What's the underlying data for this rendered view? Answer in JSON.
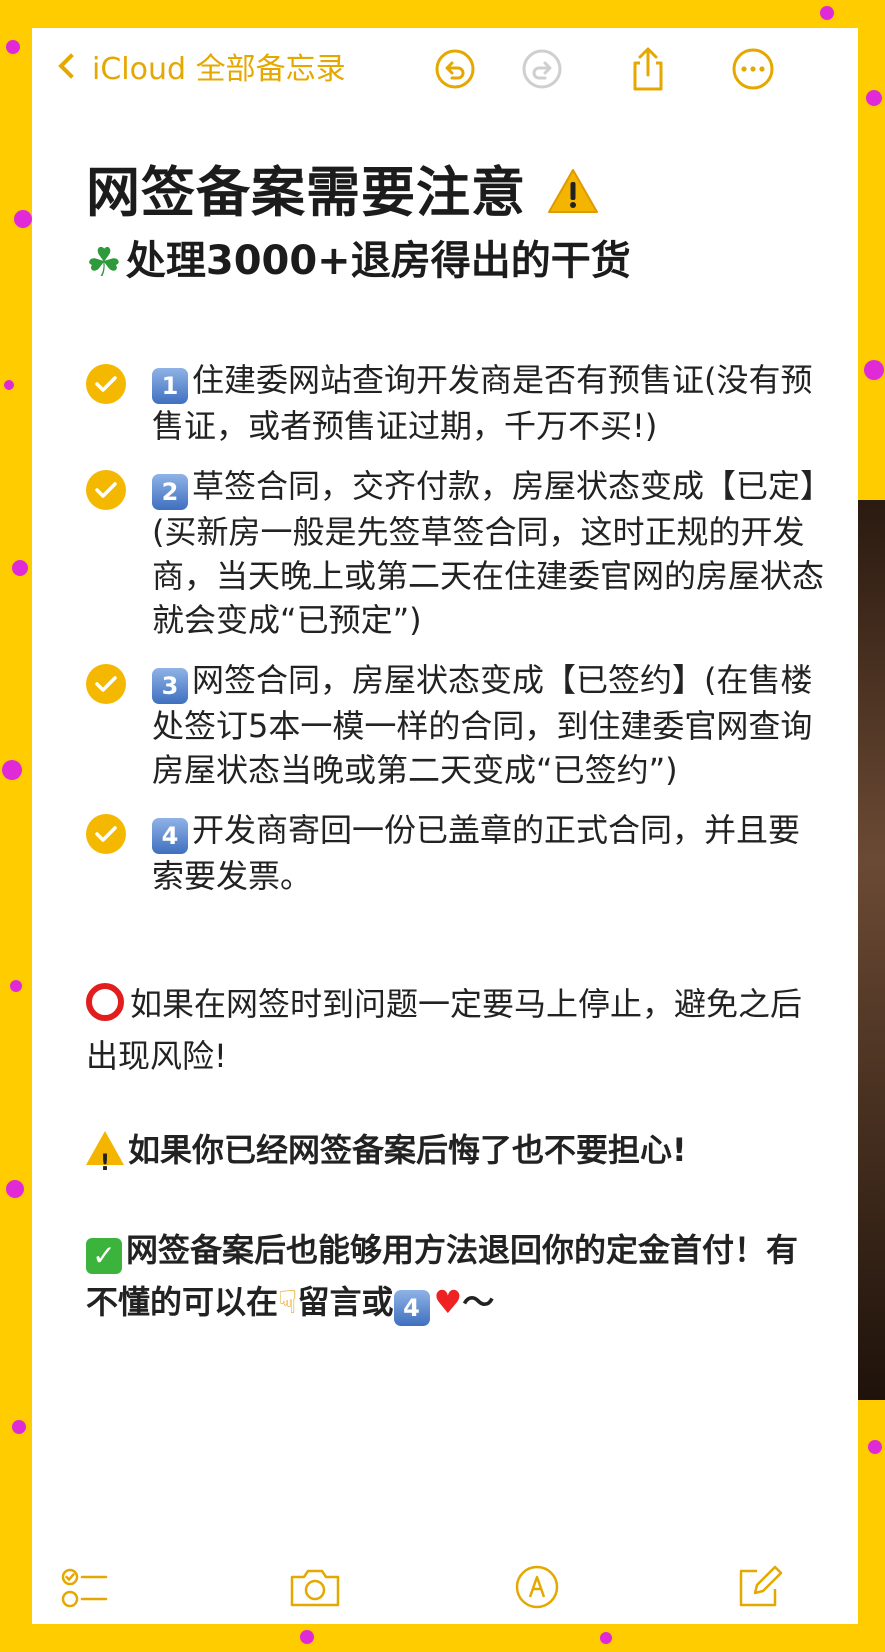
{
  "nav": {
    "back_label": "iCloud 全部备忘录",
    "icons": [
      "undo-icon",
      "redo-icon",
      "share-icon",
      "more-icon"
    ]
  },
  "note": {
    "title": "网签备案需要注意",
    "subtitle": "处理3000+退房得出的干货",
    "items": [
      {
        "badge": "1",
        "text": "住建委网站查询开发商是否有预售证(没有预售证，或者预售证过期，千万不买!)"
      },
      {
        "badge": "2",
        "text": "草签合同，交齐付款，房屋状态变成【已定】(买新房一般是先签草签合同，这时正规的开发商，当天晚上或第二天在住建委官网的房屋状态就会变成“已预定”)"
      },
      {
        "badge": "3",
        "text": "网签合同，房屋状态变成【已签约】(在售楼处签订5本一模一样的合同，到住建委官网查询房屋状态当晚或第二天变成“已签约”)"
      },
      {
        "badge": "4",
        "text": "开发商寄回一份已盖章的正式合同，并且要索要发票。"
      }
    ],
    "warning_para": "如果在网签时到问题一定要马上停止，避免之后出现风险!",
    "regret_para": "如果你已经网签备案后悔了也不要担心!",
    "refund_para_1": "网签备案后也能够用方法退回你的定金首付！有不懂的可以在",
    "refund_para_2": "留言或",
    "refund_badge": "4",
    "refund_tail": "～"
  },
  "toolbar": {
    "icons": [
      "checklist-icon",
      "camera-icon",
      "markup-icon",
      "compose-icon"
    ]
  },
  "colors": {
    "accent": "#e5a800",
    "background": "#ffcc00",
    "dots": "#e02ad8"
  }
}
